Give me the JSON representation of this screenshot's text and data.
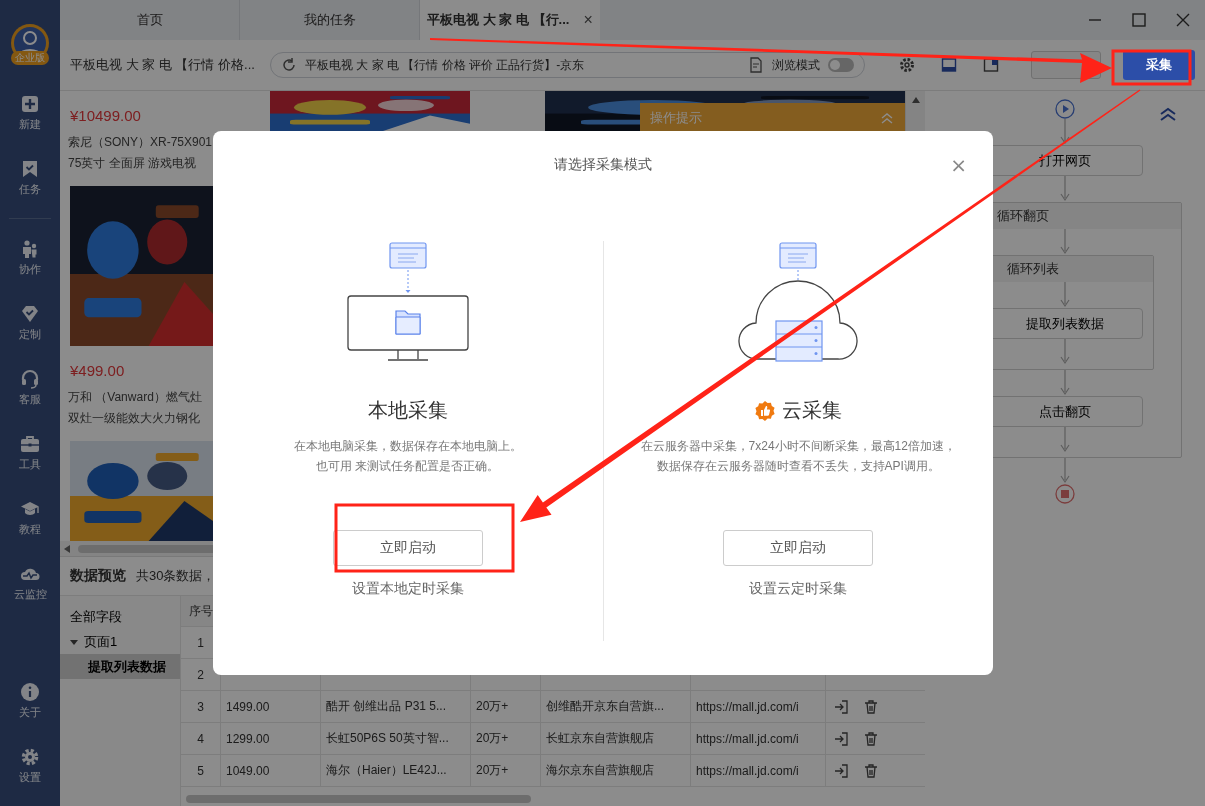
{
  "sidebar": {
    "badge": "企业版",
    "items": [
      {
        "label": "新建"
      },
      {
        "label": "任务"
      },
      {
        "label": "协作"
      },
      {
        "label": "定制"
      },
      {
        "label": "客服"
      },
      {
        "label": "工具"
      },
      {
        "label": "教程"
      },
      {
        "label": "云监控"
      }
    ],
    "bottom_items": [
      {
        "label": "关于"
      },
      {
        "label": "设置"
      }
    ]
  },
  "tabs": [
    {
      "label": "首页",
      "selected": false
    },
    {
      "label": "我的任务",
      "selected": false
    },
    {
      "label": "平板电视 大 家 电 【行...",
      "selected": true,
      "close": "×"
    }
  ],
  "toolbar": {
    "page_title": "平板电视 大 家 电 【行情 价格...",
    "url": "平板电视 大 家 电 【行情 价格 评价 正品行货】-京东",
    "browse_mode": {
      "label": "浏览模式",
      "on": false
    },
    "collect_button": "采集"
  },
  "web_page": {
    "products": [
      {
        "price": "¥10499.00",
        "title_lines": [
          "索尼（SONY）XR-75X901",
          "75英寸 全面屏 游戏电视"
        ]
      },
      {
        "price": "¥499.00",
        "title_lines": [
          "万和 （Vanward）燃气灶",
          "双灶一级能效大火力钢化"
        ]
      }
    ],
    "tip_panel": {
      "title": "操作提示"
    }
  },
  "data_preview": {
    "title": "数据预览",
    "summary": "共30条数据，",
    "tree": [
      {
        "label": "全部字段",
        "selected": false
      },
      {
        "label": "页面1",
        "selected": false,
        "expanded": true,
        "children": [
          {
            "label": "提取列表数据",
            "selected": true
          }
        ]
      }
    ],
    "table": {
      "columns": [
        "序号"
      ],
      "rows": [
        {
          "cells": [
            "1"
          ]
        },
        {
          "cells": [
            "2"
          ]
        },
        {
          "cells": [
            "3",
            "1499.00",
            "酷开 创维出品 P31 5...",
            "20万+",
            "创维酷开京东自营旗...",
            "https://mall.jd.com/i"
          ]
        },
        {
          "cells": [
            "4",
            "1299.00",
            "长虹50P6S 50英寸智...",
            "20万+",
            "长虹京东自营旗舰店",
            "https://mall.jd.com/i"
          ]
        },
        {
          "cells": [
            "5",
            "1049.00",
            "海尔（Haier）LE42J...",
            "20万+",
            "海尔京东自营旗舰店",
            "https://mall.jd.com/i"
          ]
        }
      ]
    }
  },
  "flow": {
    "steps": [
      {
        "kind": "action",
        "label": "打开网页"
      },
      {
        "kind": "loop",
        "label": "循环翻页",
        "children": [
          {
            "kind": "loop",
            "label": "循环列表",
            "children": [
              {
                "kind": "action",
                "label": "提取列表数据"
              }
            ]
          },
          {
            "kind": "action",
            "label": "点击翻页"
          }
        ]
      }
    ]
  },
  "dialog": {
    "title": "请选择采集模式",
    "close": "×",
    "modes": [
      {
        "kind": "local",
        "title": "本地采集",
        "description": [
          "在本地电脑采集，数据保存在本地电脑上。",
          "也可用 来测试任务配置是否正确。"
        ],
        "button": "立即启动",
        "link": "设置本地定时采集"
      },
      {
        "kind": "cloud",
        "title": "云采集",
        "description": [
          "在云服务器中采集，7x24小时不间断采集，最高12倍加速，",
          "数据保存在云服务器随时查看不丢失，支持API调用。"
        ],
        "button": "立即启动",
        "link": "设置云定时采集"
      }
    ]
  }
}
